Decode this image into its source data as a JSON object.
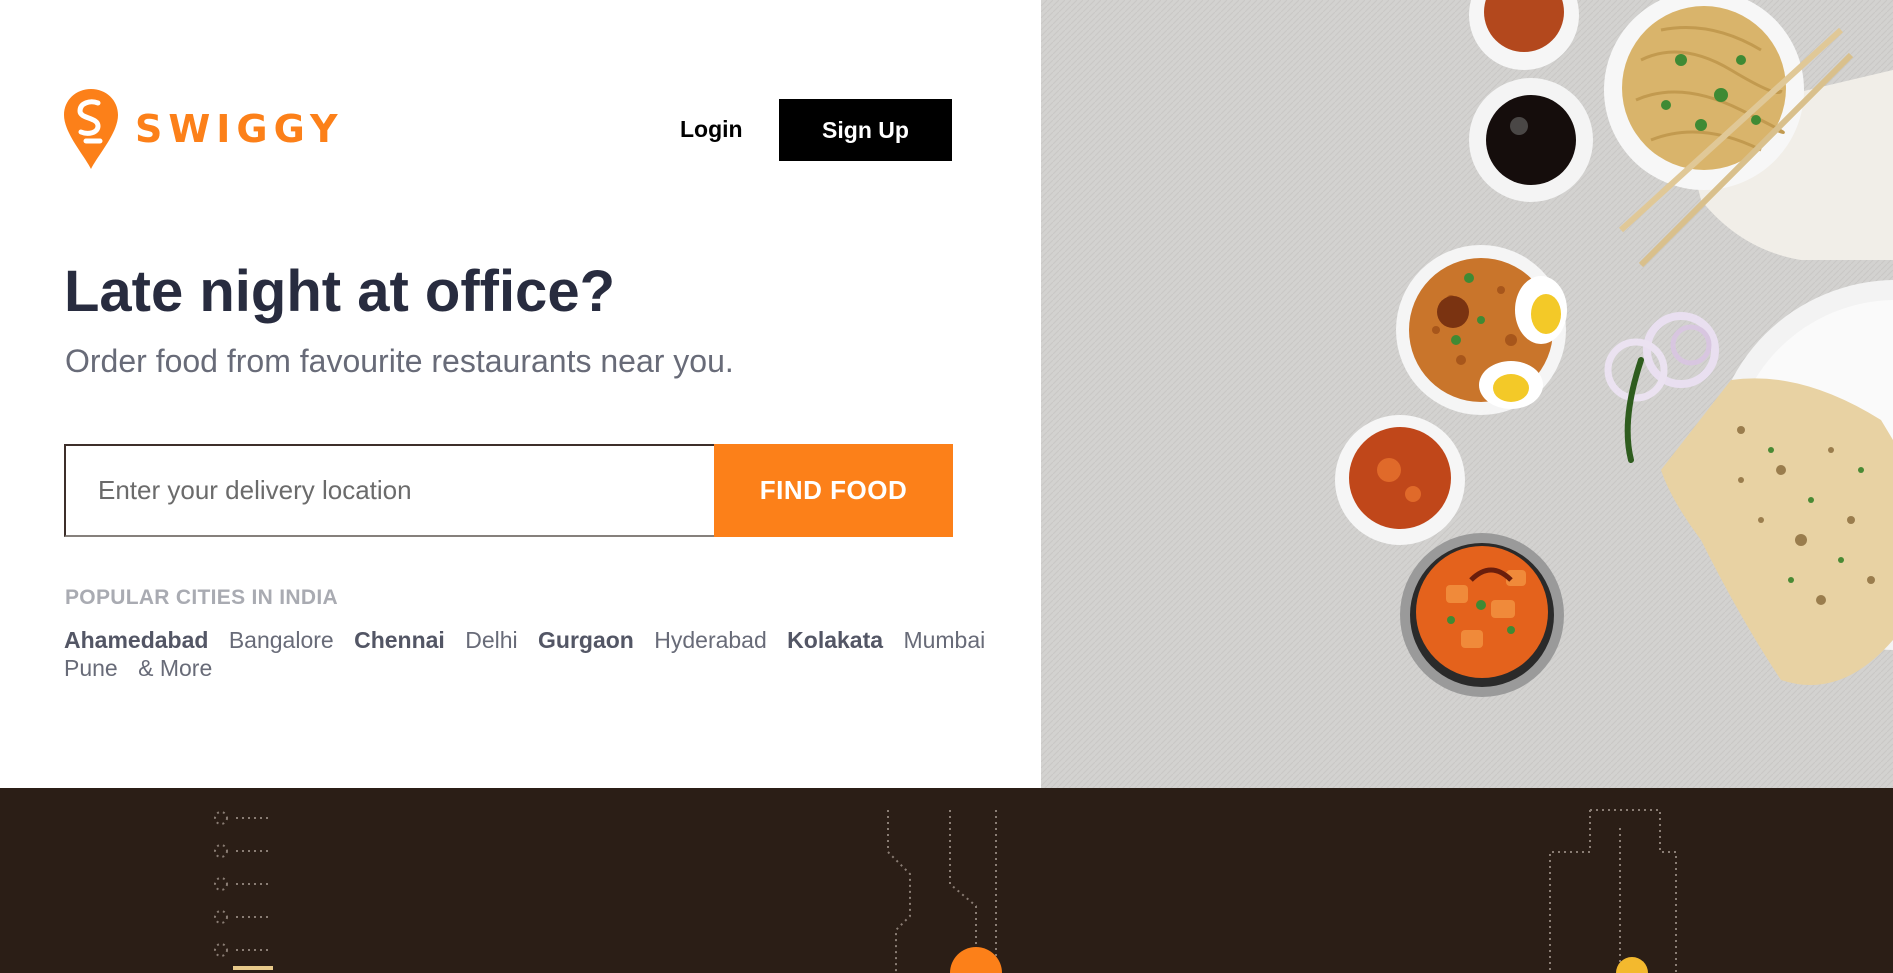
{
  "brand": {
    "name": "SWIGGY",
    "color": "#fc8019"
  },
  "header": {
    "login_label": "Login",
    "signup_label": "Sign Up"
  },
  "hero": {
    "headline": "Late night at office?",
    "subheadline": "Order food from favourite restaurants near you."
  },
  "search": {
    "placeholder": "Enter your delivery location",
    "value": "",
    "button_label": "FIND FOOD"
  },
  "popular": {
    "title": "POPULAR CITIES IN INDIA",
    "cities": [
      {
        "name": "Ahamedabad",
        "bold": true
      },
      {
        "name": "Bangalore",
        "bold": false
      },
      {
        "name": "Chennai",
        "bold": true
      },
      {
        "name": "Delhi",
        "bold": false
      },
      {
        "name": "Gurgaon",
        "bold": true
      },
      {
        "name": "Hyderabad",
        "bold": false
      },
      {
        "name": "Kolakata",
        "bold": true
      },
      {
        "name": "Mumbai",
        "bold": false
      },
      {
        "name": "Pune",
        "bold": false
      }
    ],
    "more_label": "& More"
  },
  "colors": {
    "accent": "#fc8019",
    "dark_text": "#282c3f",
    "muted_text": "#686b78",
    "footer_bg": "#2b1e16",
    "image_bg": "#d6d5d3"
  },
  "icons": [
    "swiggy-logo-icon",
    "food-spread-image",
    "dotted-illustration-icon"
  ]
}
